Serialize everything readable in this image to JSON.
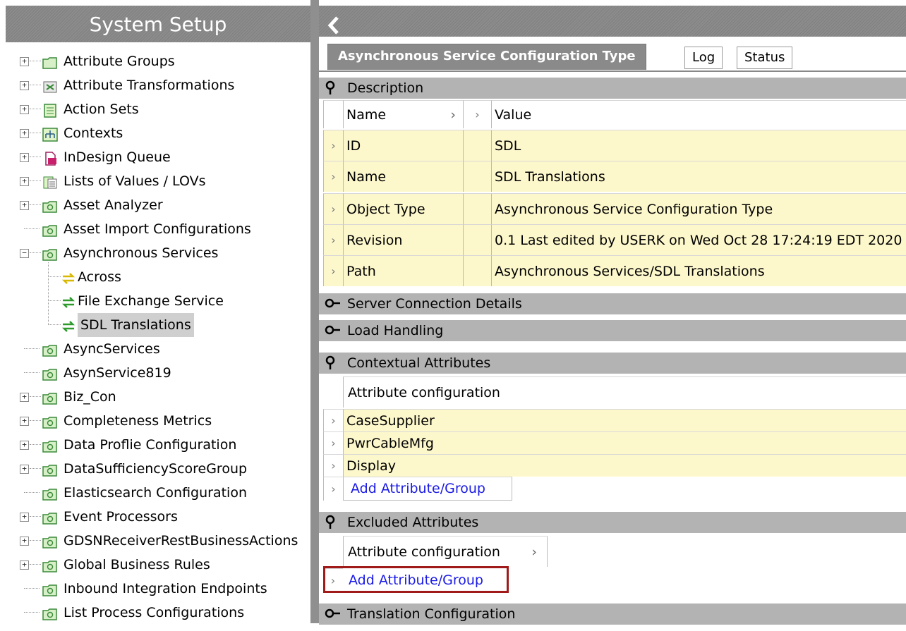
{
  "left_panel": {
    "title": "System Setup",
    "tree": [
      {
        "label": "Attribute Groups",
        "icon": "folder-icon",
        "expander": "+"
      },
      {
        "label": "Attribute Transformations",
        "icon": "transform-icon",
        "expander": "+"
      },
      {
        "label": "Action Sets",
        "icon": "action-set-icon",
        "expander": "+"
      },
      {
        "label": "Contexts",
        "icon": "contexts-icon",
        "expander": "+"
      },
      {
        "label": "InDesign Queue",
        "icon": "indesign-icon",
        "expander": "+"
      },
      {
        "label": "Lists of Values / LOVs",
        "icon": "lov-icon",
        "expander": "+"
      },
      {
        "label": "Asset Analyzer",
        "icon": "setup-folder-icon",
        "expander": "+"
      },
      {
        "label": "Asset Import Configurations",
        "icon": "setup-folder-icon",
        "expander": ""
      },
      {
        "label": "Asynchronous Services",
        "icon": "setup-folder-icon",
        "expander": "-"
      },
      {
        "label": "Across",
        "icon": "async-service-yellow-icon",
        "expander": "",
        "child": true
      },
      {
        "label": "File Exchange Service",
        "icon": "async-service-green-icon",
        "expander": "",
        "child": true
      },
      {
        "label": "SDL Translations",
        "icon": "async-service-green-icon",
        "expander": "",
        "child": true,
        "selected": true
      },
      {
        "label": "AsyncServices",
        "icon": "setup-folder-icon",
        "expander": ""
      },
      {
        "label": "AsynService819",
        "icon": "setup-folder-icon",
        "expander": ""
      },
      {
        "label": "Biz_Con",
        "icon": "setup-folder-icon",
        "expander": "+"
      },
      {
        "label": "Completeness Metrics",
        "icon": "setup-folder-icon",
        "expander": "+"
      },
      {
        "label": "Data Proflie Configuration",
        "icon": "setup-folder-icon",
        "expander": "+"
      },
      {
        "label": "DataSufficiencyScoreGroup",
        "icon": "setup-folder-icon",
        "expander": "+"
      },
      {
        "label": "Elasticsearch Configuration",
        "icon": "setup-folder-icon",
        "expander": ""
      },
      {
        "label": "Event Processors",
        "icon": "setup-folder-icon",
        "expander": "+"
      },
      {
        "label": "GDSNReceiverRestBusinessActions",
        "icon": "setup-folder-icon",
        "expander": "+"
      },
      {
        "label": "Global Business Rules",
        "icon": "setup-folder-icon",
        "expander": "+"
      },
      {
        "label": "Inbound Integration Endpoints",
        "icon": "setup-folder-icon",
        "expander": ""
      },
      {
        "label": "List Process Configurations",
        "icon": "setup-folder-icon",
        "expander": ""
      }
    ]
  },
  "right_panel": {
    "tabs": {
      "active": "Asynchronous Service Configuration Type",
      "log": "Log",
      "status": "Status"
    },
    "description": {
      "title": "Description",
      "col_name": "Name",
      "col_value": "Value",
      "rows": [
        {
          "name": "ID",
          "value": "SDL"
        },
        {
          "name": "Name",
          "value": "SDL Translations"
        },
        {
          "name": "Object Type",
          "value": "Asynchronous Service Configuration Type"
        },
        {
          "name": "Revision",
          "value": "0.1 Last edited by USERK on Wed Oct 28 17:24:19 EDT 2020"
        },
        {
          "name": "Path",
          "value": "Asynchronous Services/SDL Translations"
        }
      ]
    },
    "server_connection": {
      "title": "Server Connection Details"
    },
    "load_handling": {
      "title": "Load Handling"
    },
    "contextual_attributes": {
      "title": "Contextual Attributes",
      "header": "Attribute configuration",
      "rows": [
        "CaseSupplier",
        "PwrCableMfg",
        "Display"
      ],
      "add_link": "Add Attribute/Group"
    },
    "excluded_attributes": {
      "title": "Excluded Attributes",
      "header": "Attribute configuration",
      "add_link": "Add Attribute/Group"
    },
    "translation_config": {
      "title": "Translation Configuration"
    }
  }
}
